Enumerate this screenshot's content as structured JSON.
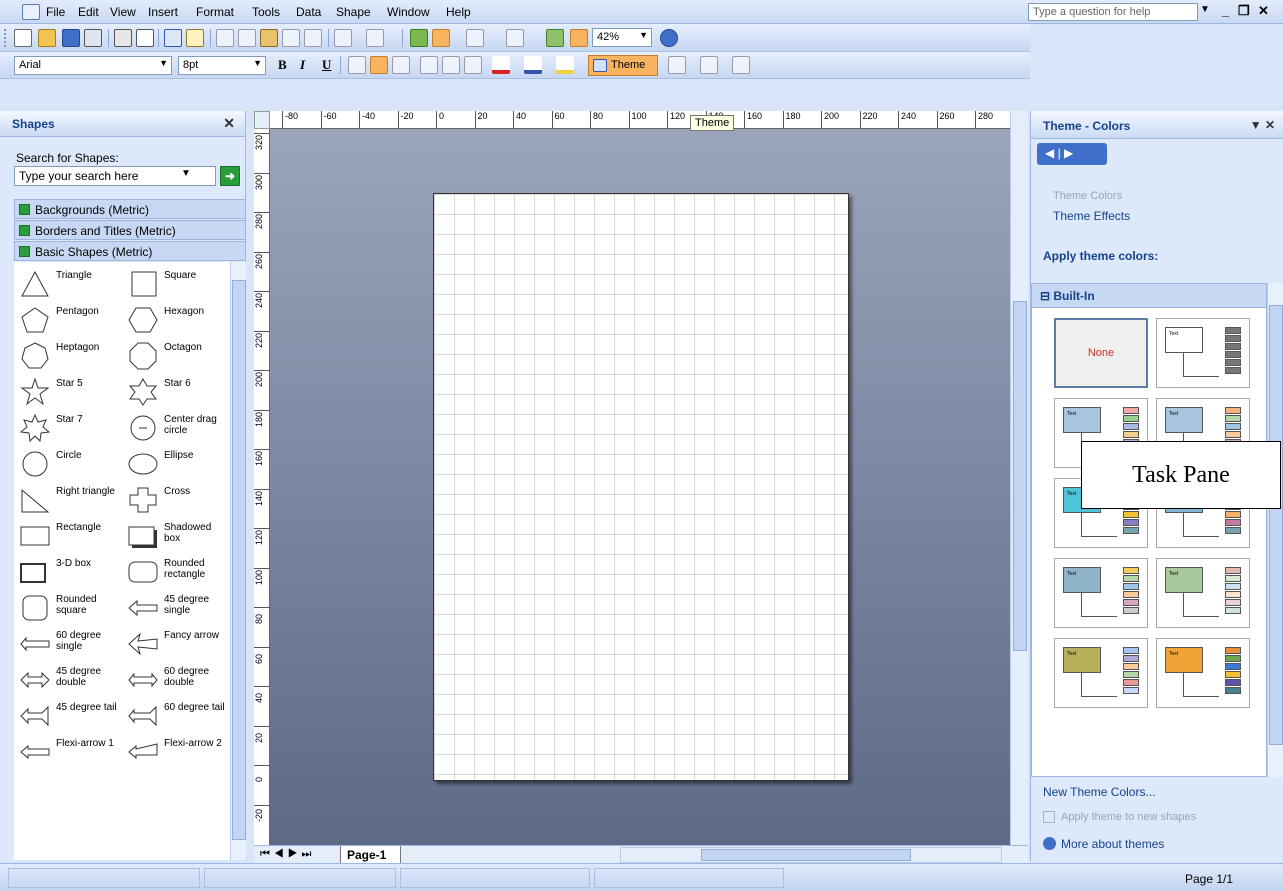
{
  "menu": {
    "items": [
      "File",
      "Edit",
      "View",
      "Insert",
      "Format",
      "Tools",
      "Data",
      "Shape",
      "Window",
      "Help"
    ],
    "help_placeholder": "Type a question for help"
  },
  "toolbar": {
    "zoom": "42%",
    "font": "Arial",
    "font_size": "8pt",
    "theme_label": "Theme",
    "theme_tooltip": "Theme"
  },
  "shapes_pane": {
    "title": "Shapes",
    "search_label": "Search for Shapes:",
    "search_placeholder": "Type your search here",
    "stencils": [
      "Backgrounds (Metric)",
      "Borders and Titles (Metric)",
      "Basic Shapes (Metric)"
    ],
    "shapes": [
      {
        "label": "Triangle",
        "icon": "triangle-icon"
      },
      {
        "label": "Square",
        "icon": "square-icon"
      },
      {
        "label": "Pentagon",
        "icon": "pentagon-icon"
      },
      {
        "label": "Hexagon",
        "icon": "hexagon-icon"
      },
      {
        "label": "Heptagon",
        "icon": "heptagon-icon"
      },
      {
        "label": "Octagon",
        "icon": "octagon-icon"
      },
      {
        "label": "Star 5",
        "icon": "star5-icon"
      },
      {
        "label": "Star 6",
        "icon": "star6-icon"
      },
      {
        "label": "Star 7",
        "icon": "star7-icon"
      },
      {
        "label": "Center drag circle",
        "icon": "center-drag-circle-icon"
      },
      {
        "label": "Circle",
        "icon": "circle-icon"
      },
      {
        "label": "Ellipse",
        "icon": "ellipse-icon"
      },
      {
        "label": "Right triangle",
        "icon": "right-triangle-icon"
      },
      {
        "label": "Cross",
        "icon": "cross-icon"
      },
      {
        "label": "Rectangle",
        "icon": "rectangle-icon"
      },
      {
        "label": "Shadowed box",
        "icon": "shadowed-box-icon"
      },
      {
        "label": "3-D box",
        "icon": "3d-box-icon"
      },
      {
        "label": "Rounded rectangle",
        "icon": "rounded-rectangle-icon"
      },
      {
        "label": "Rounded square",
        "icon": "rounded-square-icon"
      },
      {
        "label": "45 degree single",
        "icon": "arrow-45-single-icon"
      },
      {
        "label": "60 degree single",
        "icon": "arrow-60-single-icon"
      },
      {
        "label": "Fancy arrow",
        "icon": "fancy-arrow-icon"
      },
      {
        "label": "45 degree double",
        "icon": "arrow-45-double-icon"
      },
      {
        "label": "60 degree double",
        "icon": "arrow-60-double-icon"
      },
      {
        "label": "45 degree tail",
        "icon": "arrow-45-tail-icon"
      },
      {
        "label": "60 degree tail",
        "icon": "arrow-60-tail-icon"
      },
      {
        "label": "Flexi-arrow 1",
        "icon": "flexi-arrow-1-icon"
      },
      {
        "label": "Flexi-arrow 2",
        "icon": "flexi-arrow-2-icon"
      }
    ]
  },
  "ruler": {
    "h_ticks": [
      "-80",
      "-60",
      "-40",
      "-20",
      "0",
      "20",
      "40",
      "60",
      "80",
      "100",
      "120",
      "140",
      "160",
      "180",
      "200",
      "220",
      "240",
      "260",
      "280"
    ],
    "v_ticks": [
      "320",
      "300",
      "280",
      "260",
      "240",
      "220",
      "200",
      "180",
      "160",
      "140",
      "120",
      "100",
      "80",
      "60",
      "40",
      "20",
      "0",
      "-20"
    ]
  },
  "page_tab": "Page-1",
  "task_pane": {
    "title": "Theme - Colors",
    "link_theme_colors": "Theme Colors",
    "link_theme_effects": "Theme Effects",
    "apply_heading": "Apply theme colors:",
    "group_label": "Built-In",
    "none_label": "None",
    "tile_text": "Text",
    "callout": "Task Pane",
    "new_theme_colors": "New Theme Colors...",
    "apply_new_shapes": "Apply theme to new shapes",
    "more_themes": "More about themes",
    "themes": [
      {
        "box": "#ffffff",
        "stack": [
          "#777777",
          "#777777",
          "#777777",
          "#777777",
          "#777777",
          "#777777"
        ]
      },
      {
        "box": "#a9c4de",
        "stack": [
          "#f2a7a7",
          "#9ad08f",
          "#a8b8e8",
          "#f3d08a",
          "#c6a8e0",
          "#e8c2a0"
        ]
      },
      {
        "box": "#a9c4de",
        "stack": [
          "#f7b183",
          "#b6d7a8",
          "#9fc5e8",
          "#f9cb9c",
          "#d5a6bd",
          "#a2c4c9"
        ]
      },
      {
        "box": "#4fc3d8",
        "stack": [
          "#e06666",
          "#6aa84f",
          "#3d85c6",
          "#f1c232",
          "#8e7cc3",
          "#76a5af"
        ]
      },
      {
        "box": "#7fb6d6",
        "stack": [
          "#ffd966",
          "#93c47d",
          "#6fa8dc",
          "#f6b26b",
          "#c27ba0",
          "#76a5af"
        ]
      },
      {
        "box": "#8fb3c9",
        "stack": [
          "#f4cc5a",
          "#b6d7a8",
          "#9fc5e8",
          "#f9cb9c",
          "#d5a6bd",
          "#cccccc"
        ]
      },
      {
        "box": "#a9c89b",
        "stack": [
          "#e6b8af",
          "#d9ead3",
          "#cfe2f3",
          "#fce5cd",
          "#ead1dc",
          "#d0e0e3"
        ]
      },
      {
        "box": "#b7b05a",
        "stack": [
          "#a4c2f4",
          "#b4a7d6",
          "#f9cb9c",
          "#b6d7a8",
          "#ea9999",
          "#c9daf8"
        ]
      },
      {
        "box": "#f0a436",
        "stack": [
          "#e69138",
          "#6aa84f",
          "#3c78d8",
          "#f1c232",
          "#674ea7",
          "#45818e"
        ]
      },
      {
        "box": "#f5b400",
        "stack": [
          "#cc4125",
          "#38761d",
          "#1155cc",
          "#bf9000",
          "#351c75",
          "#134f5c"
        ]
      }
    ]
  },
  "status": {
    "page_count": "Page 1/1"
  }
}
